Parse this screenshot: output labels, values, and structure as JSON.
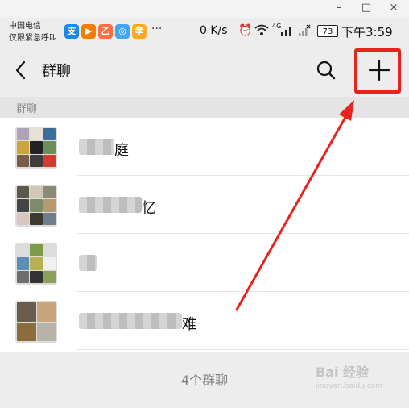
{
  "window": {
    "minimize_icon": "–",
    "maximize_icon": "□",
    "close_icon": "×"
  },
  "status": {
    "carrier_line1": "中国电信",
    "carrier_line2": "仅限紧急呼叫",
    "apps": [
      "支",
      "▶",
      "乙",
      "◎",
      "孝"
    ],
    "more": "···",
    "net_speed": "0 K/s",
    "signal_label": "4G",
    "battery": "73",
    "time": "下午3:59"
  },
  "header": {
    "title": "群聊"
  },
  "section": {
    "label": "群聊"
  },
  "groups": [
    {
      "name_visible": "庭"
    },
    {
      "name_visible": "忆"
    },
    {
      "name_visible": ""
    },
    {
      "name_visible": "难"
    }
  ],
  "footer": {
    "count_label": "4个群聊"
  },
  "watermark": {
    "brand": "Bai 经验",
    "url": "jingyan.baidu.com"
  },
  "colors": {
    "highlight": "#e8231c",
    "background": "#ededed"
  }
}
